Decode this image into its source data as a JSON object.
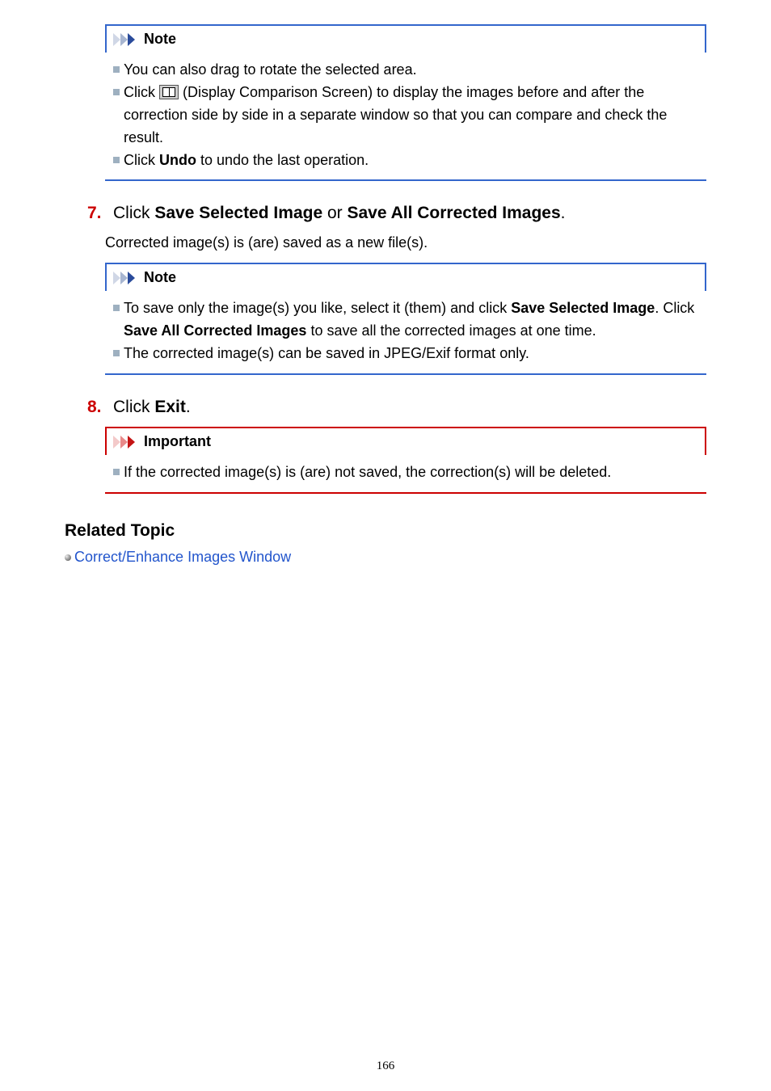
{
  "note1": {
    "heading": "Note",
    "items": {
      "a": "You can also drag to rotate the selected area.",
      "b_pre": "Click ",
      "b_post": " (Display Comparison Screen) to display the images before and after the correction side by side in a separate window so that you can compare and check the result.",
      "c_pre": "Click ",
      "c_bold": "Undo",
      "c_post": " to undo the last operation."
    }
  },
  "step7": {
    "num": "7.",
    "pre": "Click ",
    "bold1": "Save Selected Image",
    "mid": " or ",
    "bold2": "Save All Corrected Images",
    "post": ".",
    "sub": "Corrected image(s) is (are) saved as a new file(s)."
  },
  "note2": {
    "heading": "Note",
    "items": {
      "a_pre": "To save only the image(s) you like, select it (them) and click ",
      "a_b1": "Save Selected Image",
      "a_mid": ". Click ",
      "a_b2": "Save All Corrected Images",
      "a_post": " to save all the corrected images at one time.",
      "b": "The corrected image(s) can be saved in JPEG/Exif format only."
    }
  },
  "step8": {
    "num": "8.",
    "pre": "Click ",
    "bold": "Exit",
    "post": "."
  },
  "important": {
    "heading": "Important",
    "items": {
      "a": "If the corrected image(s) is (are) not saved, the correction(s) will be deleted."
    }
  },
  "related": {
    "heading": "Related Topic",
    "link": "Correct/Enhance Images Window"
  },
  "page_number": "166"
}
